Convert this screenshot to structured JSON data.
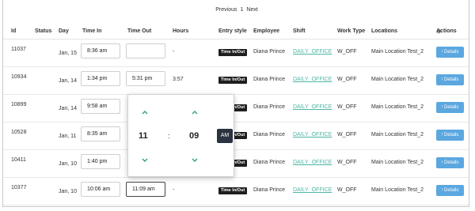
{
  "pagination": {
    "prev": "Previous",
    "page": "1",
    "next": "Next"
  },
  "columns": {
    "id": "Id",
    "status": "Status",
    "day": "Day",
    "time_in": "Time In",
    "time_out": "Time Out",
    "hours": "Hours",
    "entry_style": "Entry style",
    "employee": "Employee",
    "shift": "Shift",
    "work_type": "Work Type",
    "locations": "Locations",
    "actions": "Actions"
  },
  "rows": [
    {
      "id": "11037",
      "day": "Jan, 15",
      "time_in": "8:36 am",
      "time_out": "",
      "hours": "-",
      "entry_style": "Time In/Out",
      "employee": "Diana Prince",
      "shift": "DAILY_OFFICE",
      "work_type": "W_OFF",
      "location": "Main Location Test_2",
      "action": "Details"
    },
    {
      "id": "10934",
      "day": "Jan, 14",
      "time_in": "1:34 pm",
      "time_out": "5:31 pm",
      "hours": "3:57",
      "entry_style": "Time In/Out",
      "employee": "Diana Prince",
      "shift": "DAILY_OFFICE",
      "work_type": "W_OFF",
      "location": "Main Location Test_2",
      "action": "Details"
    },
    {
      "id": "10899",
      "day": "Jan, 14",
      "time_in": "9:58 am",
      "time_out": "",
      "hours": "",
      "entry_style": "Time In/Out",
      "employee": "Diana Prince",
      "shift": "DAILY_OFFICE",
      "work_type": "W_OFF",
      "location": "Main Location Test_2",
      "action": "Details"
    },
    {
      "id": "10528",
      "day": "Jan, 11",
      "time_in": "8:35 am",
      "time_out": "",
      "hours": "",
      "entry_style": "Time In/Out",
      "employee": "Diana Prince",
      "shift": "DAILY_OFFICE",
      "work_type": "W_OFF",
      "location": "Main Location Test_2",
      "action": "Details"
    },
    {
      "id": "10411",
      "day": "Jan, 10",
      "time_in": "1:40 pm",
      "time_out": "",
      "hours": "",
      "entry_style": "Time In/Out",
      "employee": "Diana Prince",
      "shift": "DAILY_OFFICE",
      "work_type": "W_OFF",
      "location": "Main Location Test_2",
      "action": "Details"
    },
    {
      "id": "10377",
      "day": "Jan, 10",
      "time_in": "10:06 am",
      "time_out": "11:09 am",
      "hours": "-",
      "entry_style": "Time In/Out",
      "employee": "Diana Prince",
      "shift": "DAILY_OFFICE",
      "work_type": "W_OFF",
      "location": "Main Location Test_2",
      "action": "Details"
    }
  ],
  "time_picker": {
    "hour": "11",
    "separator": ":",
    "minute": "09",
    "period": "AM"
  },
  "icons": {
    "actions": "gear-icon",
    "details": "info-icon",
    "picker_up": "chevron-up-icon",
    "picker_down": "chevron-down-icon"
  },
  "colors": {
    "details_button": "#5ba7e0",
    "shift_link": "#4db6a5",
    "entry_badge": "#1f1f1f",
    "ampm_button": "#2b3340",
    "chevron": "#2e9e8a"
  }
}
